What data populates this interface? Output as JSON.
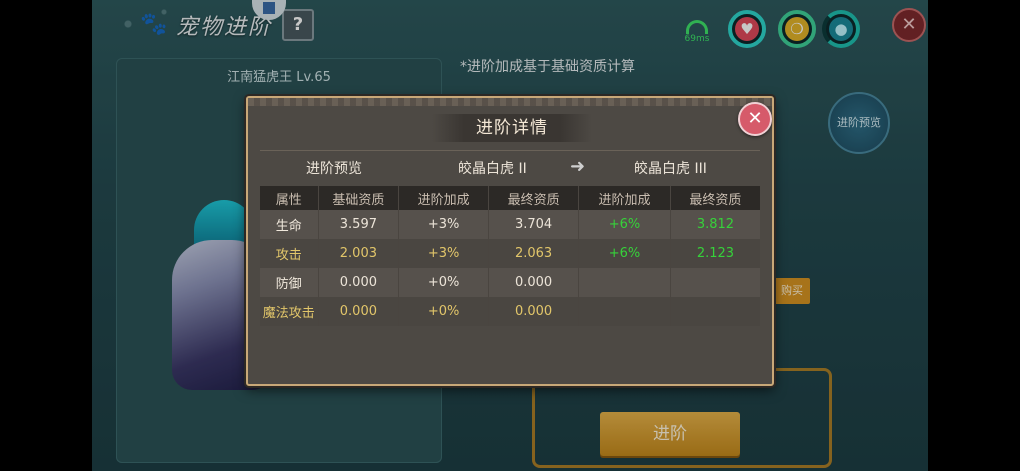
{
  "screen": {
    "title": "宠物进阶",
    "help_label": "?",
    "ping": "69ms",
    "info_text": "*进阶加成基于基础资质计算",
    "pet_name": "江南猛虎王 Lv.65",
    "preview_button": "进阶预览",
    "buy_button": "购买",
    "advance_button": "进阶",
    "colors": {
      "accent_gold": "#d79422",
      "dialog_bg": "#4d4944",
      "positive_green": "#36d23a"
    }
  },
  "icons": [
    "paw-icon",
    "bookmark-icon",
    "signal-icon",
    "heart-icon",
    "food-icon",
    "water-drop-icon",
    "close-icon",
    "arrow-right-icon"
  ],
  "dialog": {
    "title": "进阶详情",
    "close_label": "✕",
    "preview_label": "进阶预览",
    "current_tier": "皎晶白虎 II",
    "next_tier": "皎晶白虎 III",
    "columns": [
      "属性",
      "基础资质",
      "进阶加成",
      "最终资质",
      "进阶加成",
      "最终资质"
    ],
    "rows": [
      {
        "attr": "生命",
        "base": "3.597",
        "bonus": "+3%",
        "final": "3.704",
        "next_bonus": "+6%",
        "next_final": "3.812"
      },
      {
        "attr": "攻击",
        "base": "2.003",
        "bonus": "+3%",
        "final": "2.063",
        "next_bonus": "+6%",
        "next_final": "2.123"
      },
      {
        "attr": "防御",
        "base": "0.000",
        "bonus": "+0%",
        "final": "0.000",
        "next_bonus": "",
        "next_final": ""
      },
      {
        "attr": "魔法攻击",
        "base": "0.000",
        "bonus": "+0%",
        "final": "0.000",
        "next_bonus": "",
        "next_final": ""
      }
    ]
  }
}
